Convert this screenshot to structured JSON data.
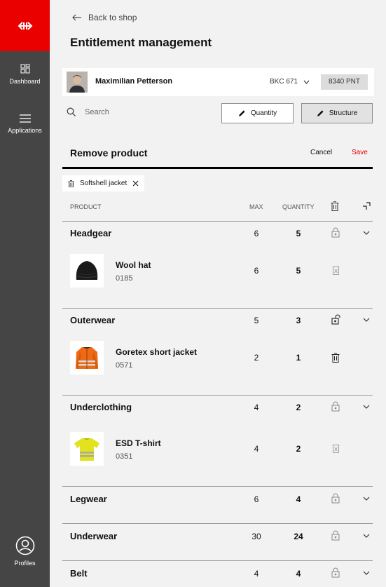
{
  "sidebar": {
    "items": [
      {
        "label": "Dashboard",
        "icon": "dashboard-icon"
      },
      {
        "label": "Applications",
        "icon": "menu-icon"
      },
      {
        "label": "Profiles",
        "icon": "profile-icon"
      }
    ]
  },
  "header": {
    "back_label": "Back to shop",
    "title": "Entitlement management"
  },
  "user": {
    "name": "Maximilian Petterson",
    "account": "BKC 671",
    "points": "8340 PNT"
  },
  "toolbar": {
    "search_placeholder": "Search",
    "quantity_label": "Quantity",
    "structure_label": "Structure"
  },
  "section": {
    "title": "Remove product",
    "cancel_label": "Cancel",
    "save_label": "Save"
  },
  "filter_chip": {
    "label": "Softshell jacket"
  },
  "table": {
    "columns": {
      "product": "PRODUCT",
      "max": "MAX",
      "quantity": "QUANTITY"
    },
    "categories": [
      {
        "name": "Headgear",
        "max": "6",
        "quantity": "5",
        "lock": "locked",
        "product": {
          "name": "Wool hat",
          "code": "0185",
          "max": "6",
          "quantity": "5"
        }
      },
      {
        "name": "Outerwear",
        "max": "5",
        "quantity": "3",
        "lock": "unlocked",
        "product": {
          "name": "Goretex short jacket",
          "code": "0571",
          "max": "2",
          "quantity": "1"
        }
      },
      {
        "name": "Underclothing",
        "max": "4",
        "quantity": "2",
        "lock": "locked",
        "product": {
          "name": "ESD T-shirt",
          "code": "0351",
          "max": "4",
          "quantity": "2"
        }
      },
      {
        "name": "Legwear",
        "max": "6",
        "quantity": "4",
        "lock": "locked"
      },
      {
        "name": "Underwear",
        "max": "30",
        "quantity": "24",
        "lock": "locked"
      },
      {
        "name": "Belt",
        "max": "4",
        "quantity": "4",
        "lock": "locked"
      }
    ]
  },
  "colors": {
    "brand_red": "#eb0000",
    "sidebar": "#454545",
    "background": "#f2f2f2"
  }
}
